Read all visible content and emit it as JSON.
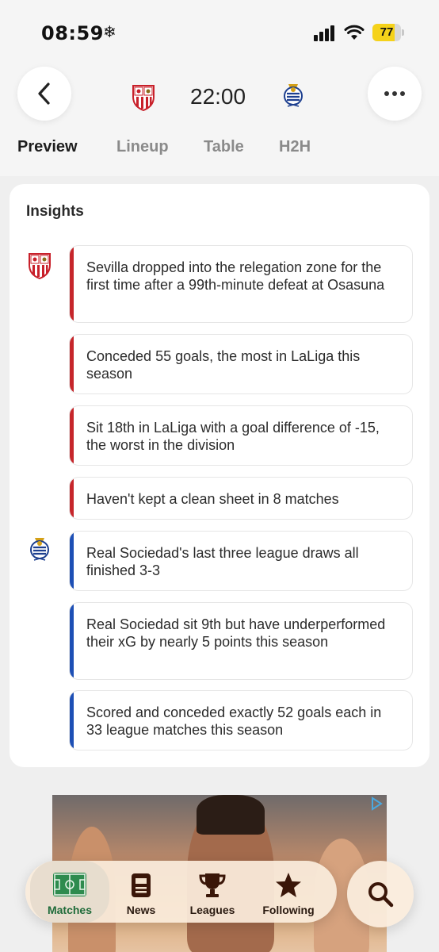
{
  "status_bar": {
    "time": "08:59",
    "snow_glyph": "❄",
    "battery_level": "77"
  },
  "header": {
    "back_icon": "chevron-left-icon",
    "more_icon": "more-horizontal-icon",
    "home_crest": "sevilla-crest",
    "away_crest": "real-sociedad-crest",
    "kickoff_time": "22:00",
    "tabs": [
      {
        "label": "Preview",
        "active": true
      },
      {
        "label": "Lineup",
        "active": false
      },
      {
        "label": "Table",
        "active": false
      },
      {
        "label": "H2H",
        "active": false
      }
    ]
  },
  "insights": {
    "title": "Insights",
    "colors": {
      "home": "#c6262b",
      "away": "#1d4fb5"
    },
    "items": [
      {
        "team": "home",
        "text": "Sevilla dropped into the relegation zone for the first time after a 99th-minute defeat at Osasuna"
      },
      {
        "team": "home",
        "text": "Conceded 55 goals, the most in LaLiga this season"
      },
      {
        "team": "home",
        "text": "Sit 18th in LaLiga with a goal difference of -15, the worst in the division"
      },
      {
        "team": "home",
        "text": "Haven't kept a clean sheet in 8 matches"
      },
      {
        "team": "away",
        "text": "Real Sociedad's last three league draws all finished 3-3"
      },
      {
        "team": "away",
        "text": "Real Sociedad sit 9th but have underperformed their xG by nearly 5 points this season"
      },
      {
        "team": "away",
        "text": "Scored and conceded exactly 52 goals each in 33 league matches this season"
      }
    ]
  },
  "ad": {
    "badge_icon": "ad-choices-icon"
  },
  "bottom_nav": {
    "items": [
      {
        "label": "Matches",
        "icon": "pitch-icon",
        "active": true
      },
      {
        "label": "News",
        "icon": "news-icon",
        "active": false
      },
      {
        "label": "Leagues",
        "icon": "trophy-icon",
        "active": false
      },
      {
        "label": "Following",
        "icon": "star-icon",
        "active": false
      }
    ],
    "search_icon": "search-icon",
    "accent": "#1f6b3a"
  }
}
